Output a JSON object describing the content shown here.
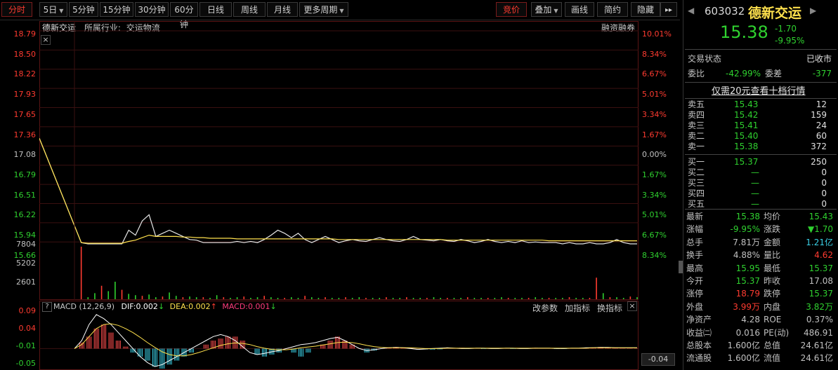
{
  "toolbar": {
    "tabs": [
      "分时",
      "5日",
      "5分钟",
      "15分钟",
      "30分钟",
      "60分钟",
      "日线",
      "周线",
      "月线",
      "更多周期"
    ],
    "right_buttons": [
      "竞价",
      "叠加",
      "画线",
      "简约",
      "隐藏"
    ],
    "more_arrows": "▸▸"
  },
  "chart_header": {
    "name": "德新交运",
    "industry_label": "所属行业:",
    "industry": "交运物流",
    "margin_label": "融资融券",
    "close_glyph": "×"
  },
  "price_axis_left": [
    "18.79",
    "18.50",
    "18.22",
    "17.93",
    "17.65",
    "17.36",
    "17.08",
    "16.79",
    "16.51",
    "16.22",
    "15.94",
    "15.66"
  ],
  "pct_axis_right": [
    "10.01%",
    "8.34%",
    "6.67%",
    "5.01%",
    "3.34%",
    "1.67%",
    "0.00%",
    "1.67%",
    "3.34%",
    "5.01%",
    "6.67%",
    "8.34%"
  ],
  "volume_axis": [
    "7804",
    "5202",
    "2601"
  ],
  "macd": {
    "help": "?",
    "title": "MACD (12,26,9)",
    "dif": "DIF:0.002",
    "dea": "DEA:0.002",
    "macd_val": "MACD:0.001",
    "arrow_down": "↓",
    "arrow_up": "↑",
    "buttons": [
      "改参数",
      "加指标",
      "换指标"
    ],
    "close": "×",
    "axis": [
      "0.09",
      "0.04",
      "-0.01",
      "-0.05"
    ],
    "corner_value": "-0.04"
  },
  "chart_data": {
    "type": "line",
    "title": "",
    "series": [
      {
        "values": [
          17.08,
          15.4,
          15.38,
          15.38,
          15.38,
          15.38,
          15.38,
          15.38,
          15.6,
          15.52,
          15.75,
          15.85,
          15.5,
          15.55,
          15.6,
          15.55,
          15.5,
          15.45,
          15.44,
          15.4,
          15.4,
          15.4,
          15.4,
          15.4,
          15.42,
          15.4,
          15.42,
          15.4,
          15.45,
          15.52,
          15.6,
          15.55,
          15.48,
          15.55,
          15.45,
          15.4,
          15.45,
          15.5,
          15.45,
          15.4,
          15.43,
          15.45,
          15.43,
          15.42,
          15.45,
          15.48,
          15.45,
          15.43,
          15.42,
          15.45,
          15.5,
          15.45,
          15.44,
          15.43,
          15.45,
          15.43,
          15.42,
          15.45,
          15.43,
          15.4,
          15.42,
          15.45,
          15.42,
          15.4,
          15.42,
          15.4,
          15.43,
          15.4,
          15.41,
          15.4,
          15.4,
          15.4,
          15.38,
          15.4,
          15.38,
          15.38,
          15.4,
          15.38,
          15.38,
          15.4,
          15.45,
          15.4,
          15.38,
          15.38
        ]
      },
      {
        "values": [
          17.08,
          15.4,
          15.39,
          15.39,
          15.39,
          15.39,
          15.39,
          15.39,
          15.42,
          15.44,
          15.48,
          15.52,
          15.5,
          15.5,
          15.5,
          15.5,
          15.49,
          15.49,
          15.48,
          15.48,
          15.47,
          15.47,
          15.47,
          15.47,
          15.46,
          15.46,
          15.46,
          15.46,
          15.46,
          15.46,
          15.46,
          15.46,
          15.46,
          15.46,
          15.46,
          15.46,
          15.46,
          15.46,
          15.46,
          15.45,
          15.45,
          15.45,
          15.45,
          15.45,
          15.45,
          15.45,
          15.45,
          15.45,
          15.45,
          15.45,
          15.45,
          15.45,
          15.45,
          15.45,
          15.45,
          15.44,
          15.44,
          15.44,
          15.44,
          15.44,
          15.44,
          15.44,
          15.44,
          15.44,
          15.44,
          15.44,
          15.44,
          15.44,
          15.44,
          15.44,
          15.43,
          15.43,
          15.43,
          15.43,
          15.43,
          15.43,
          15.43,
          15.43,
          15.43,
          15.43,
          15.43,
          15.43,
          15.43,
          15.43
        ]
      }
    ],
    "volume": [
      0,
      7804,
      300,
      900,
      2000,
      1200,
      2600,
      1400,
      800,
      600,
      500,
      700,
      300,
      400,
      1000,
      500,
      300,
      400,
      300,
      300,
      200,
      600,
      300,
      200,
      300,
      400,
      200,
      300,
      500,
      300,
      200,
      200,
      300,
      200,
      500,
      300,
      200,
      300,
      200,
      200,
      300,
      200,
      300,
      200,
      200,
      200,
      300,
      200,
      200,
      300,
      200,
      200,
      200,
      300,
      200,
      200,
      200,
      200,
      300,
      200,
      200,
      200,
      200,
      300,
      200,
      200,
      200,
      200,
      300,
      200,
      200,
      200,
      200,
      300,
      200,
      200,
      200,
      3200,
      900,
      300,
      300,
      200,
      400,
      300
    ],
    "macd_hist": [
      0.0,
      0.015,
      0.03,
      0.05,
      0.06,
      0.04,
      0.02,
      0.005,
      -0.01,
      -0.02,
      -0.03,
      -0.045,
      -0.05,
      -0.04,
      -0.03,
      -0.02,
      -0.01,
      0.0,
      0.01,
      0.02,
      0.025,
      0.03,
      0.03,
      0.02,
      0.0,
      -0.015,
      -0.02,
      -0.015,
      -0.01,
      0.0,
      -0.01,
      -0.02,
      -0.01,
      0.0,
      0.01,
      0.02,
      0.03,
      0.02,
      0.01,
      0.0,
      -0.01,
      -0.005,
      0.0,
      0.003,
      0.004,
      0.003,
      0.002,
      0.0,
      -0.002,
      -0.003,
      -0.002,
      0.0,
      0.001,
      0.002,
      0.001,
      0.0,
      -0.001,
      0.0,
      0.001,
      0.0,
      -0.001,
      0.0,
      0.001,
      0.002,
      0.001,
      0.0,
      -0.001,
      -0.001,
      0.0,
      0.001,
      0.002,
      0.003,
      0.004,
      0.003,
      0.002,
      0.001,
      0.001,
      0.001
    ],
    "macd_dif": [
      0.0,
      0.02,
      0.06,
      0.085,
      0.075,
      0.06,
      0.04,
      0.02,
      0.0,
      -0.02,
      -0.035,
      -0.045,
      -0.04,
      -0.03,
      -0.02,
      -0.01,
      0.0,
      0.01,
      0.02,
      0.03,
      0.035,
      0.03,
      0.02,
      0.005,
      -0.01,
      -0.015,
      -0.012,
      -0.008,
      -0.005,
      0.0,
      0.005,
      0.01,
      0.012,
      0.015,
      0.02,
      0.025,
      0.028,
      0.02,
      0.01,
      0.0,
      -0.005,
      -0.003,
      0.0,
      0.002,
      0.003,
      0.002,
      0.0,
      -0.002,
      -0.001,
      0.0,
      0.001,
      0.002,
      0.001,
      0.0,
      0.0,
      0.001,
      0.001,
      0.0,
      0.0,
      0.001,
      0.001,
      0.0,
      0.0,
      0.001,
      0.001,
      0.001,
      0.0,
      0.0,
      0.001,
      0.001,
      0.002,
      0.002,
      0.003,
      0.003,
      0.002,
      0.002,
      0.002,
      0.002
    ],
    "macd_dea": [
      0.0,
      0.01,
      0.03,
      0.05,
      0.06,
      0.062,
      0.058,
      0.05,
      0.04,
      0.028,
      0.015,
      0.003,
      -0.008,
      -0.015,
      -0.018,
      -0.018,
      -0.015,
      -0.01,
      -0.004,
      0.002,
      0.008,
      0.012,
      0.014,
      0.013,
      0.01,
      0.005,
      0.001,
      -0.002,
      -0.003,
      -0.003,
      -0.001,
      0.002,
      0.004,
      0.006,
      0.009,
      0.012,
      0.015,
      0.016,
      0.015,
      0.012,
      0.008,
      0.005,
      0.003,
      0.002,
      0.002,
      0.002,
      0.002,
      0.001,
      0.0,
      0.0,
      0.0,
      0.001,
      0.001,
      0.001,
      0.001,
      0.001,
      0.001,
      0.001,
      0.001,
      0.001,
      0.001,
      0.001,
      0.001,
      0.001,
      0.001,
      0.001,
      0.001,
      0.001,
      0.001,
      0.001,
      0.001,
      0.002,
      0.002,
      0.002,
      0.002,
      0.002,
      0.002,
      0.002
    ],
    "ylim": [
      15.38,
      18.79
    ],
    "pre_close": 17.08,
    "volume_max": 7804,
    "macd_ylim": [
      -0.05,
      0.09
    ]
  },
  "quote": {
    "code": "603032",
    "name": "德新交运",
    "price": "15.38",
    "change": "-1.70",
    "pct": "-9.95%",
    "status_label": "交易状态",
    "status": "已收市",
    "wb_label": "委比",
    "wb": "-42.99%",
    "wc_label": "委差",
    "wc": "-377",
    "promo": "仅需20元查看十档行情"
  },
  "orderbook": {
    "sell": [
      {
        "label": "卖五",
        "price": "15.43",
        "vol": "12"
      },
      {
        "label": "卖四",
        "price": "15.42",
        "vol": "159"
      },
      {
        "label": "卖三",
        "price": "15.41",
        "vol": "24"
      },
      {
        "label": "卖二",
        "price": "15.40",
        "vol": "60"
      },
      {
        "label": "卖一",
        "price": "15.38",
        "vol": "372"
      }
    ],
    "buy": [
      {
        "label": "买一",
        "price": "15.37",
        "vol": "250"
      },
      {
        "label": "买二",
        "price": "—",
        "vol": "0"
      },
      {
        "label": "买三",
        "price": "—",
        "vol": "0"
      },
      {
        "label": "买四",
        "price": "—",
        "vol": "0"
      },
      {
        "label": "买五",
        "price": "—",
        "vol": "0"
      }
    ]
  },
  "stats": [
    {
      "l1": "最新",
      "v1": "15.38",
      "c1": "green",
      "l2": "均价",
      "v2": "15.43",
      "c2": "green"
    },
    {
      "l1": "涨幅",
      "v1": "-9.95%",
      "c1": "green",
      "l2": "涨跌",
      "v2": "▼1.70",
      "c2": "green"
    },
    {
      "l1": "总手",
      "v1": "7.81万",
      "c1": "gray",
      "l2": "金额",
      "v2": "1.21亿",
      "c2": "cyan"
    },
    {
      "l1": "换手",
      "v1": "4.88%",
      "c1": "gray",
      "l2": "量比",
      "v2": "4.62",
      "c2": "red"
    },
    {
      "l1": "最高",
      "v1": "15.95",
      "c1": "green",
      "l2": "最低",
      "v2": "15.37",
      "c2": "green"
    },
    {
      "l1": "今开",
      "v1": "15.37",
      "c1": "green",
      "l2": "昨收",
      "v2": "17.08",
      "c2": "gray"
    },
    {
      "l1": "涨停",
      "v1": "18.79",
      "c1": "red",
      "l2": "跌停",
      "v2": "15.37",
      "c2": "green"
    },
    {
      "l1": "外盘",
      "v1": "3.99万",
      "c1": "red",
      "l2": "内盘",
      "v2": "3.82万",
      "c2": "green"
    },
    {
      "l1": "净资产",
      "v1": "4.28",
      "c1": "gray",
      "l2": "ROE",
      "v2": "0.37%",
      "c2": "gray"
    },
    {
      "l1": "收益㈡",
      "v1": "0.016",
      "c1": "gray",
      "l2": "PE(动)",
      "v2": "486.91",
      "c2": "gray"
    },
    {
      "l1": "总股本",
      "v1": "1.600亿",
      "c1": "gray",
      "l2": "总值",
      "v2": "24.61亿",
      "c2": "gray"
    },
    {
      "l1": "流通股",
      "v1": "1.600亿",
      "c1": "gray",
      "l2": "流值",
      "v2": "24.61亿",
      "c2": "gray"
    }
  ],
  "colors": {
    "up": "#ff3b30",
    "down": "#2fd12f",
    "price_line": "#e8e8e8",
    "avg_line": "#ffe14d",
    "frame": "#5a1414",
    "macd_pos": "#ff4d4d",
    "macd_neg": "#3ad0e6"
  }
}
